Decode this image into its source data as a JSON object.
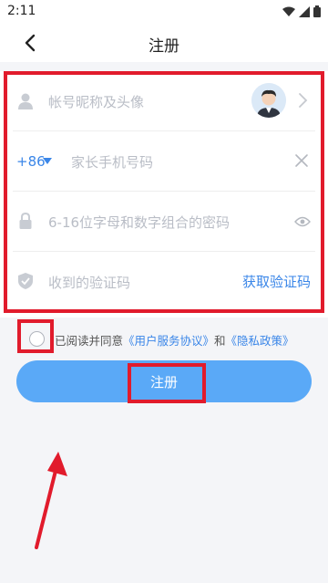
{
  "status_bar": {
    "time": "2:11"
  },
  "nav": {
    "title": "注册"
  },
  "form": {
    "nickname_placeholder": "帐号昵称及头像",
    "country_code": "+86",
    "phone_placeholder": "家长手机号码",
    "password_placeholder": "6-16位字母和数字组合的密码",
    "code_placeholder": "收到的验证码",
    "get_code_label": "获取验证码"
  },
  "agreement": {
    "prefix": "已阅读并同意",
    "user_agreement": "《用户服务协议》",
    "conjunction": "和",
    "privacy_policy": "《隐私政策》"
  },
  "register_button": {
    "label": "注册"
  },
  "colors": {
    "accent": "#3a86e8",
    "button": "#5aa9f7",
    "annotation": "#e11b2c"
  }
}
